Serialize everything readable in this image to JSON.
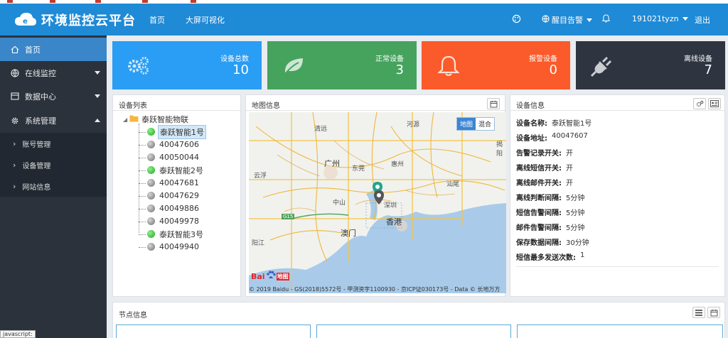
{
  "app": {
    "title": "环境监控云平台"
  },
  "navbar": {
    "links": [
      "首页",
      "大屏可视化"
    ],
    "alarm_label": "醒目告警",
    "user": "191021tyzn",
    "logout": "退出"
  },
  "sidebar": {
    "items": [
      {
        "label": "首页"
      },
      {
        "label": "在线监控"
      },
      {
        "label": "数据中心"
      },
      {
        "label": "系统管理"
      }
    ],
    "sub_items": [
      {
        "label": "账号管理"
      },
      {
        "label": "设备管理"
      },
      {
        "label": "网站信息"
      }
    ]
  },
  "cards": [
    {
      "label": "设备总数",
      "value": "10",
      "color": "#2a9df4"
    },
    {
      "label": "正常设备",
      "value": "3",
      "color": "#46a35e"
    },
    {
      "label": "报警设备",
      "value": "0",
      "color": "#fb5a2a"
    },
    {
      "label": "离线设备",
      "value": "7",
      "color": "#2f3540"
    }
  ],
  "device_list": {
    "title": "设备列表",
    "root": "泰跃智能物联",
    "items": [
      {
        "name": "泰跃智能1号",
        "status": "online",
        "selected": true
      },
      {
        "name": "40047606",
        "status": "offline"
      },
      {
        "name": "40050044",
        "status": "offline"
      },
      {
        "name": "泰跃智能2号",
        "status": "online"
      },
      {
        "name": "40047681",
        "status": "offline"
      },
      {
        "name": "40047629",
        "status": "offline"
      },
      {
        "name": "40049886",
        "status": "offline"
      },
      {
        "name": "40049978",
        "status": "offline"
      },
      {
        "name": "泰跃智能3号",
        "status": "online"
      },
      {
        "name": "40049940",
        "status": "offline"
      }
    ]
  },
  "map": {
    "title": "地图信息",
    "toggle": [
      "地图",
      "混合"
    ],
    "labels": [
      "清远",
      "河源",
      "揭阳",
      "广州",
      "东莞",
      "惠州",
      "云浮",
      "汕尾",
      "中山",
      "深圳",
      "香港",
      "澳门",
      "阳江",
      "G15"
    ],
    "logo_text": "Bai",
    "logo_suffix": "地图",
    "copyright": "© 2019 Baidu - GS(2018)5572号 - 甲测资字1100930 - 京ICP证030173号 - Data © 长地万方"
  },
  "device_info": {
    "title": "设备信息",
    "rows": [
      {
        "k": "设备名称:",
        "v": "泰跃智能1号"
      },
      {
        "k": "设备地址:",
        "v": "40047607"
      },
      {
        "k": "告警记录开关:",
        "v": "开"
      },
      {
        "k": "离线短信开关:",
        "v": "开"
      },
      {
        "k": "离线邮件开关:",
        "v": "开"
      },
      {
        "k": "离线判断间隔:",
        "v": "5分钟"
      },
      {
        "k": "短信告警间隔:",
        "v": "5分钟"
      },
      {
        "k": "邮件告警间隔:",
        "v": "5分钟"
      },
      {
        "k": "保存数据间隔:",
        "v": "30分钟"
      },
      {
        "k": "短信最多发送次数:",
        "v": "1"
      }
    ]
  },
  "node_info": {
    "title": "节点信息"
  },
  "status_tooltip": "javascript:"
}
